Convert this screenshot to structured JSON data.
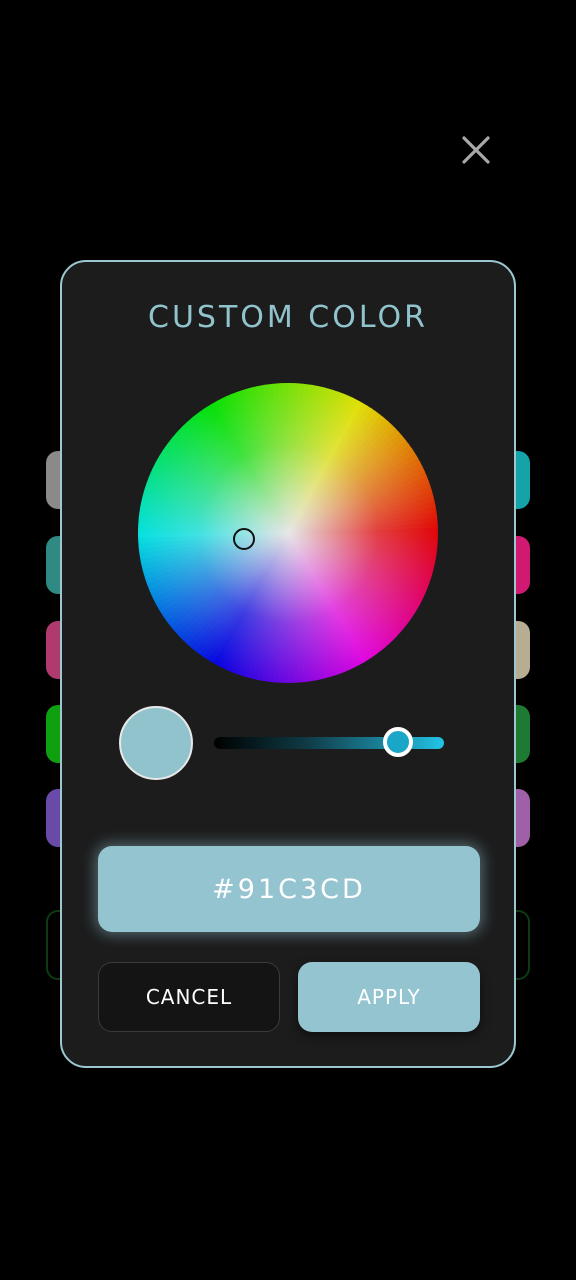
{
  "dialog": {
    "title": "CUSTOM COLOR",
    "hex_value": "#91C3CD",
    "cancel_label": "CANCEL",
    "apply_label": "APPLY",
    "brightness_level": 0.8
  },
  "colors": {
    "accent": "#91C3CD",
    "dialog_bg": "#1C1C1D",
    "dialog_border": "#9CC7D1",
    "screen_bg": "#000000"
  },
  "icons": {
    "close": "close-icon"
  },
  "background_swatches": {
    "left": [
      "#8a8a8a",
      "#2e8a82",
      "#b03a6e",
      "#0fa010",
      "#6a4aa8"
    ],
    "right": [
      "#14a3a8",
      "#d01a72",
      "#b7ad92",
      "#1e7a32",
      "#a060a8"
    ]
  }
}
